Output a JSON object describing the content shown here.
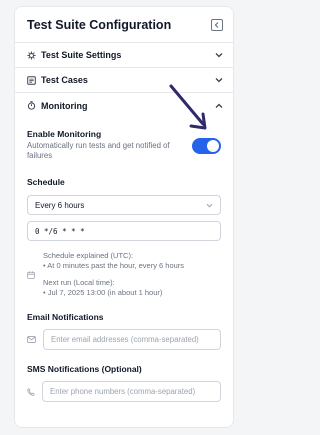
{
  "header": {
    "title": "Test Suite Configuration"
  },
  "sections": {
    "settings": {
      "label": "Test Suite Settings",
      "icon": "gear-icon"
    },
    "cases": {
      "label": "Test Cases",
      "icon": "list-icon"
    },
    "monitoring": {
      "label": "Monitoring",
      "icon": "stopwatch-icon"
    }
  },
  "monitoring": {
    "enable_title": "Enable Monitoring",
    "enable_desc": "Automatically run tests and get notified of failures",
    "enabled": true,
    "schedule_label": "Schedule",
    "schedule_value": "Every 6 hours",
    "cron_value": "0 */6 * * *",
    "explain_title": "Schedule explained (UTC):",
    "explain_line": "• At 0 minutes past the hour, every 6 hours",
    "next_title": "Next run (Local time):",
    "next_line": "• Jul 7, 2025 13:00 (in about 1 hour)",
    "email_label": "Email Notifications",
    "email_placeholder": "Enter email addresses (comma-separated)",
    "sms_label": "SMS Notifications (Optional)",
    "sms_placeholder": "Enter phone numbers (comma-separated)"
  },
  "colors": {
    "accent": "#2563eb",
    "annotation_arrow": "#2e2a6b"
  }
}
